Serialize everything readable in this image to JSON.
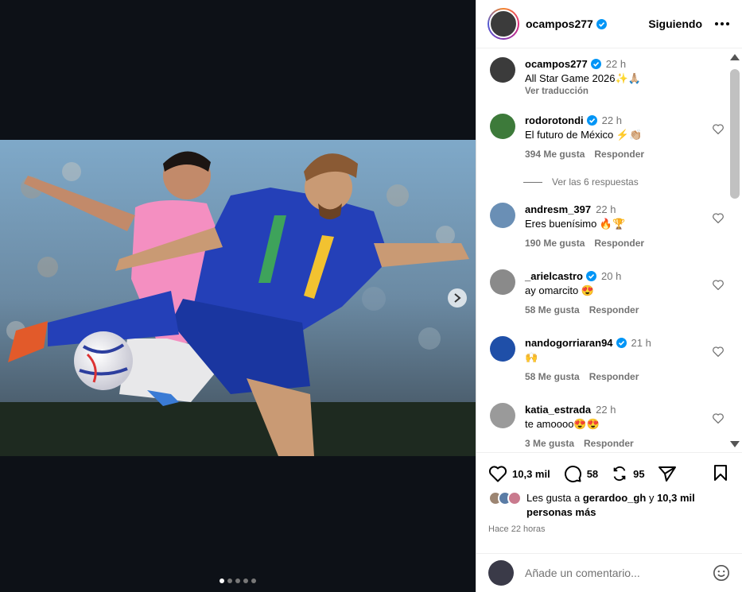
{
  "post": {
    "author": "ocampos277",
    "follow_label": "Siguiendo",
    "carousel": {
      "current": 1,
      "total": 5
    }
  },
  "caption": {
    "user": "ocampos277",
    "time": "22 h",
    "text": "All Star Game 2026✨🙏🏼",
    "translate_label": "Ver traducción"
  },
  "comments": [
    {
      "user": "rodorotondi",
      "verified": true,
      "time": "22 h",
      "text": "El futuro de México ⚡️👏🏼",
      "likes": "394 Me gusta",
      "reply": "Responder",
      "avatar_color": "#3d7a3a"
    },
    {
      "user": "andresm_397",
      "verified": false,
      "time": "22 h",
      "text": "Eres buenísimo 🔥🏆",
      "likes": "190 Me gusta",
      "reply": "Responder",
      "avatar_color": "#6a8fb5"
    },
    {
      "user": "_arielcastro",
      "verified": true,
      "time": "20 h",
      "text": "ay omarcito 😍",
      "likes": "58 Me gusta",
      "reply": "Responder",
      "avatar_color": "#8a8a8a"
    },
    {
      "user": "nandogorriaran94",
      "verified": true,
      "time": "21 h",
      "text": "🙌",
      "likes": "58 Me gusta",
      "reply": "Responder",
      "avatar_color": "#1f4fa8"
    },
    {
      "user": "katia_estrada",
      "verified": false,
      "time": "22 h",
      "text": "te amoooo😍😍",
      "likes": "3 Me gusta",
      "reply": "Responder",
      "avatar_color": "#9a9a9a"
    }
  ],
  "replies_label": "Ver las 6 respuestas",
  "actions": {
    "likes": "10,3 mil",
    "comments": "58",
    "reposts": "95"
  },
  "liked_by": {
    "prefix": "Les gusta a",
    "user": "gerardoo_gh",
    "joiner": "y",
    "others": "10,3 mil personas más"
  },
  "timestamp": "Hace 22 horas",
  "comment_box": {
    "placeholder": "Añade un comentario..."
  },
  "colors": {
    "verified": "#0095f6",
    "muted": "#737373",
    "border": "#dbdbdb"
  }
}
